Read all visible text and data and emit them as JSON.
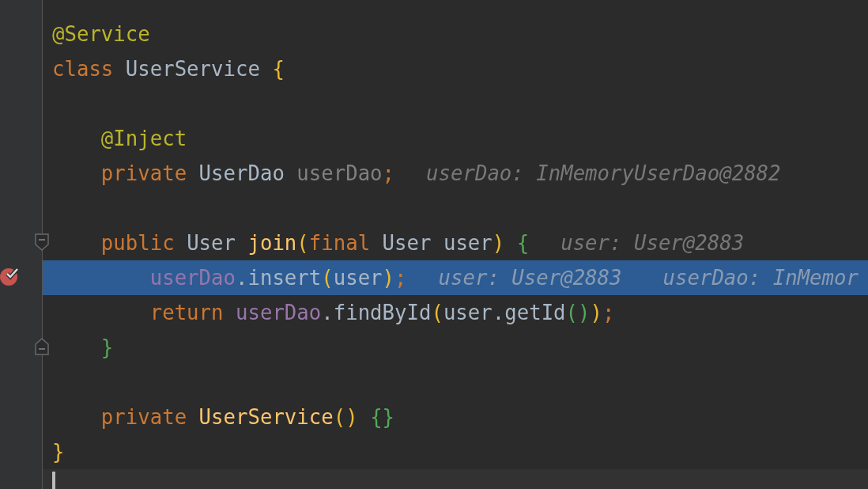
{
  "editor": {
    "lines": [
      {
        "kind": "code",
        "tokens": [
          {
            "text": "@Service",
            "kind": "annotation"
          }
        ]
      },
      {
        "kind": "code",
        "tokens": [
          {
            "text": "class ",
            "kind": "keyword"
          },
          {
            "text": "UserService ",
            "kind": "plain"
          },
          {
            "text": "{",
            "kind": "bracket",
            "color": "#e8ba36"
          }
        ]
      },
      {
        "kind": "blank"
      },
      {
        "kind": "code",
        "tokens": [
          {
            "text": "    @Inject",
            "kind": "annotation"
          }
        ]
      },
      {
        "kind": "code",
        "tokens": [
          {
            "text": "    private ",
            "kind": "keyword"
          },
          {
            "text": "UserDao ",
            "kind": "plain"
          },
          {
            "text": "userDao",
            "kind": "unused"
          },
          {
            "text": ";",
            "kind": "keyword"
          }
        ],
        "hints": [
          "userDao: InMemoryUserDao@2882"
        ]
      },
      {
        "kind": "blank"
      },
      {
        "kind": "code",
        "fold_start": true,
        "tokens": [
          {
            "text": "    public ",
            "kind": "keyword"
          },
          {
            "text": "User ",
            "kind": "plain"
          },
          {
            "text": "join",
            "kind": "method"
          },
          {
            "text": "(",
            "kind": "bracket",
            "color": "#e8ba36"
          },
          {
            "text": "final ",
            "kind": "keyword"
          },
          {
            "text": "User user",
            "kind": "plain"
          },
          {
            "text": ") ",
            "kind": "bracket",
            "color": "#e8ba36"
          },
          {
            "text": "{",
            "kind": "bracket",
            "color": "#54a857"
          }
        ],
        "hints": [
          "user: User@2883"
        ]
      },
      {
        "kind": "code",
        "breakpoint": true,
        "selected": true,
        "tokens": [
          {
            "text": "        userDao",
            "kind": "field"
          },
          {
            "text": ".insert",
            "kind": "plain"
          },
          {
            "text": "(",
            "kind": "bracket",
            "color": "#e8ba36"
          },
          {
            "text": "user",
            "kind": "plain"
          },
          {
            "text": ")",
            "kind": "bracket",
            "color": "#e8ba36"
          },
          {
            "text": ";",
            "kind": "keyword"
          }
        ],
        "hints": [
          "user: User@2883",
          "userDao: InMemor"
        ]
      },
      {
        "kind": "code",
        "selected": false,
        "tokens": [
          {
            "text": "        return ",
            "kind": "keyword"
          },
          {
            "text": "userDao",
            "kind": "field"
          },
          {
            "text": ".findById",
            "kind": "plain"
          },
          {
            "text": "(",
            "kind": "bracket",
            "color": "#e8ba36"
          },
          {
            "text": "user.getId",
            "kind": "plain"
          },
          {
            "text": "()",
            "kind": "bracket",
            "color": "#54a857"
          },
          {
            "text": ")",
            "kind": "bracket",
            "color": "#e8ba36"
          },
          {
            "text": ";",
            "kind": "keyword"
          }
        ]
      },
      {
        "kind": "code",
        "fold_end": true,
        "tokens": [
          {
            "text": "    }",
            "kind": "bracket",
            "color": "#54a857"
          }
        ]
      },
      {
        "kind": "blank"
      },
      {
        "kind": "code",
        "tokens": [
          {
            "text": "    private ",
            "kind": "keyword"
          },
          {
            "text": "UserService",
            "kind": "method"
          },
          {
            "text": "() ",
            "kind": "bracket",
            "color": "#e8ba36"
          },
          {
            "text": "{}",
            "kind": "bracket",
            "color": "#54a857"
          }
        ]
      },
      {
        "kind": "code",
        "tokens": [
          {
            "text": "}",
            "kind": "bracket",
            "color": "#e8ba36"
          }
        ]
      },
      {
        "kind": "blank",
        "current": true
      }
    ]
  }
}
